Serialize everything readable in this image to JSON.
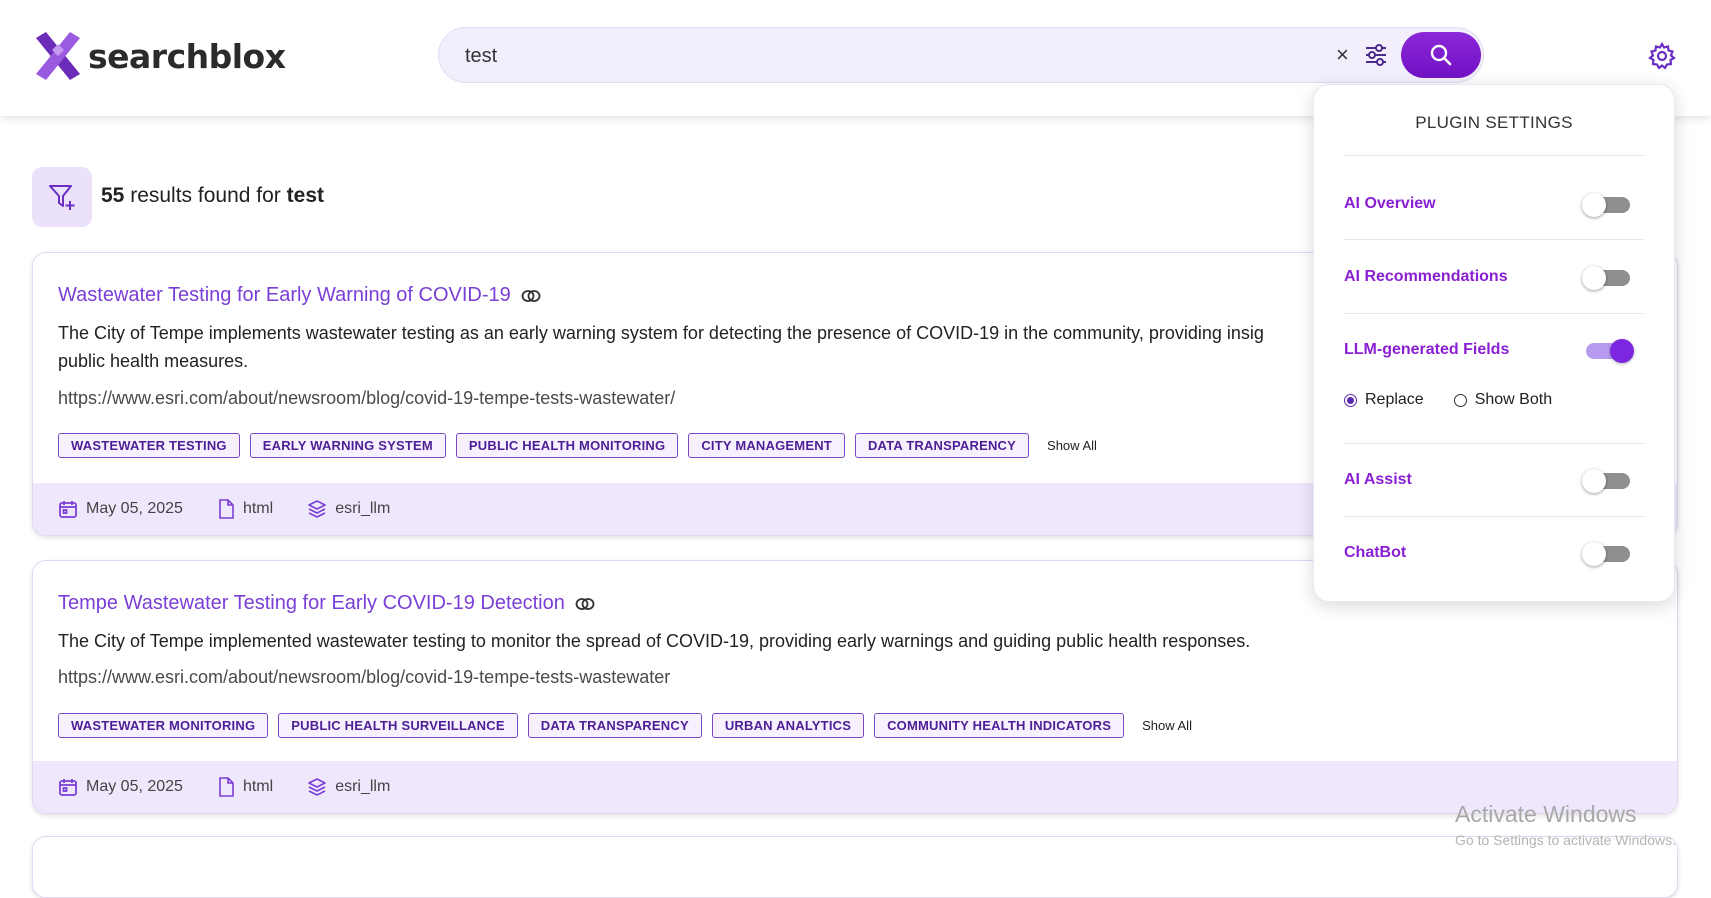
{
  "header": {
    "logo_text": "searchblox",
    "search": {
      "value": "test",
      "placeholder": ""
    }
  },
  "results": {
    "count": "55",
    "text_middle": "results found for",
    "query": "test"
  },
  "cards": [
    {
      "title": "Wastewater Testing for Early Warning of COVID-19",
      "description": "The City of Tempe implements wastewater testing as an early warning system for detecting the presence of COVID-19 in the community, providing insig",
      "description_line2": "public health measures.",
      "url": "https://www.esri.com/about/newsroom/blog/covid-19-tempe-tests-wastewater/",
      "tags": [
        "WASTEWATER TESTING",
        "EARLY WARNING SYSTEM",
        "PUBLIC HEALTH MONITORING",
        "CITY MANAGEMENT",
        "DATA TRANSPARENCY"
      ],
      "show_all": "Show All",
      "date": "May 05, 2025",
      "type": "html",
      "collection": "esri_llm"
    },
    {
      "title": "Tempe Wastewater Testing for Early COVID-19 Detection",
      "description": "The City of Tempe implemented wastewater testing to monitor the spread of COVID-19, providing early warnings and guiding public health responses.",
      "url": "https://www.esri.com/about/newsroom/blog/covid-19-tempe-tests-wastewater",
      "tags": [
        "WASTEWATER MONITORING",
        "PUBLIC HEALTH SURVEILLANCE",
        "DATA TRANSPARENCY",
        "URBAN ANALYTICS",
        "COMMUNITY HEALTH INDICATORS"
      ],
      "show_all": "Show All",
      "date": "May 05, 2025",
      "type": "html",
      "collection": "esri_llm"
    }
  ],
  "plugin_settings": {
    "title": "PLUGIN SETTINGS",
    "items": [
      {
        "label": "AI Overview",
        "enabled": false
      },
      {
        "label": "AI Recommendations",
        "enabled": false
      },
      {
        "label": "LLM-generated Fields",
        "enabled": true
      },
      {
        "label": "AI Assist",
        "enabled": false
      },
      {
        "label": "ChatBot",
        "enabled": false
      }
    ],
    "radio_options": [
      {
        "label": "Replace",
        "checked": true
      },
      {
        "label": "Show Both",
        "checked": false
      }
    ]
  },
  "watermark": {
    "title": "Activate Windows",
    "subtitle": "Go to Settings to activate Windows."
  },
  "colors": {
    "accent": "#7a3fd6",
    "brand_purple": "#7d28e0",
    "footer_bg": "#efe7fc"
  },
  "icons": [
    "logo-mark-icon",
    "clear-icon",
    "filter-sliders-icon",
    "search-icon",
    "gear-icon",
    "filter-add-icon",
    "link-icon",
    "calendar-icon",
    "file-icon",
    "layers-icon"
  ]
}
